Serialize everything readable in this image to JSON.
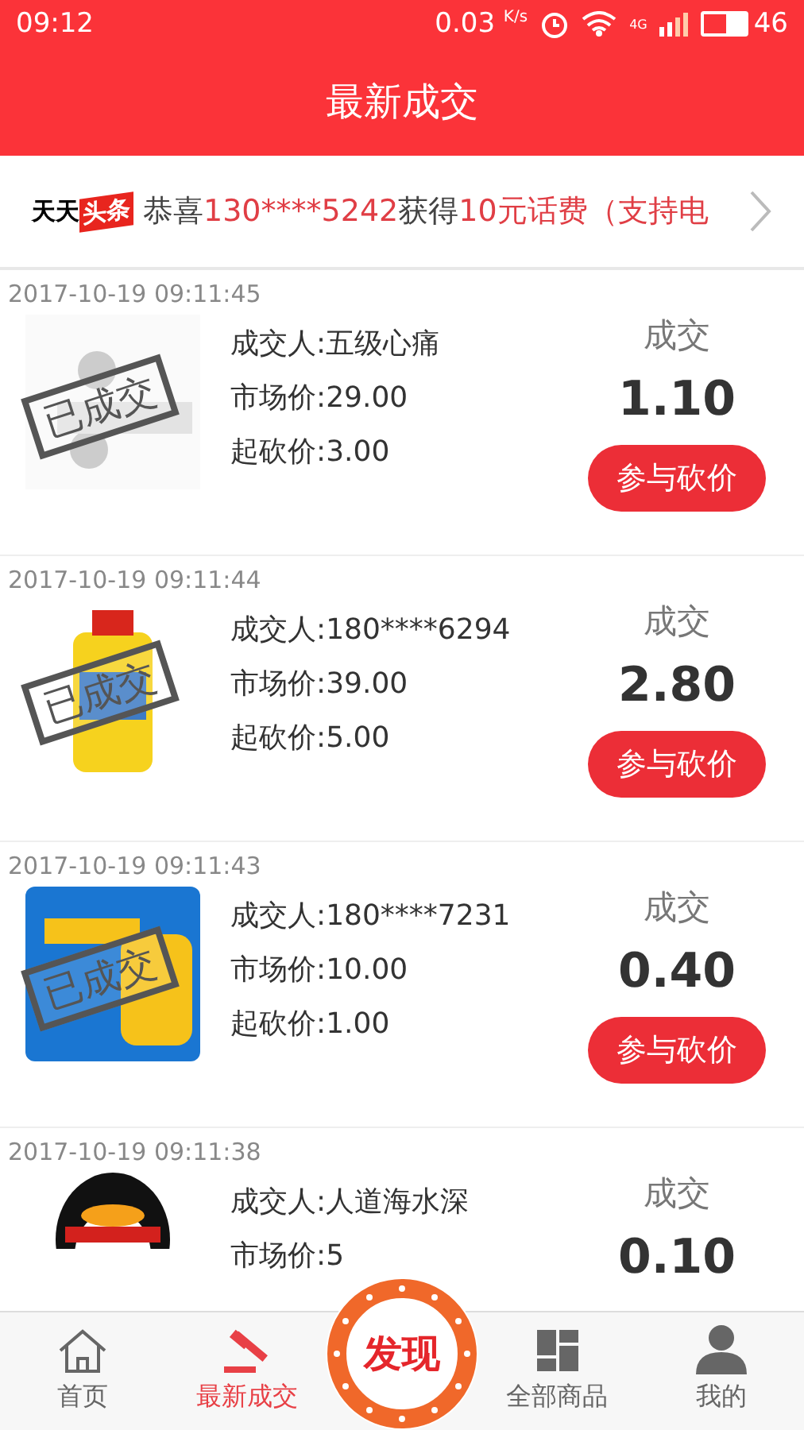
{
  "status_bar": {
    "time": "09:12",
    "speed": "0.03",
    "speed_unit": "K/s",
    "network": "4G",
    "battery": "46"
  },
  "header": {
    "title": "最新成交"
  },
  "ticker": {
    "logo_left": "天天",
    "logo_right": "头条",
    "parts": [
      {
        "text": "恭喜",
        "kind": "plain"
      },
      {
        "text": "130****5242",
        "kind": "highlight"
      },
      {
        "text": "获得",
        "kind": "plain"
      },
      {
        "text": "10元话费（支持电",
        "kind": "highlight"
      }
    ]
  },
  "deals": [
    {
      "time": "2017-10-19 09:11:45",
      "stamp": "已成交",
      "buyer": "成交人:五级心痛",
      "market": "市场价:29.00",
      "start": "起砍价:3.00",
      "status": "成交",
      "price": "1.10",
      "button": "参与砍价"
    },
    {
      "time": "2017-10-19 09:11:44",
      "stamp": "已成交",
      "buyer": "成交人:180****6294",
      "market": "市场价:39.00",
      "start": "起砍价:5.00",
      "status": "成交",
      "price": "2.80",
      "button": "参与砍价"
    },
    {
      "time": "2017-10-19 09:11:43",
      "stamp": "已成交",
      "buyer": "成交人:180****7231",
      "market": "市场价:10.00",
      "start": "起砍价:1.00",
      "status": "成交",
      "price": "0.40",
      "button": "参与砍价"
    },
    {
      "time": "2017-10-19 09:11:38",
      "buyer": "成交人:人道海水深",
      "market": "市场价:5",
      "status": "成交",
      "price": "0.10"
    }
  ],
  "tabs": [
    {
      "label": "首页",
      "selected": false
    },
    {
      "label": "最新成交",
      "selected": true
    },
    {
      "label": "发现",
      "selected": false
    },
    {
      "label": "全部商品",
      "selected": false
    },
    {
      "label": "我的",
      "selected": false
    }
  ]
}
